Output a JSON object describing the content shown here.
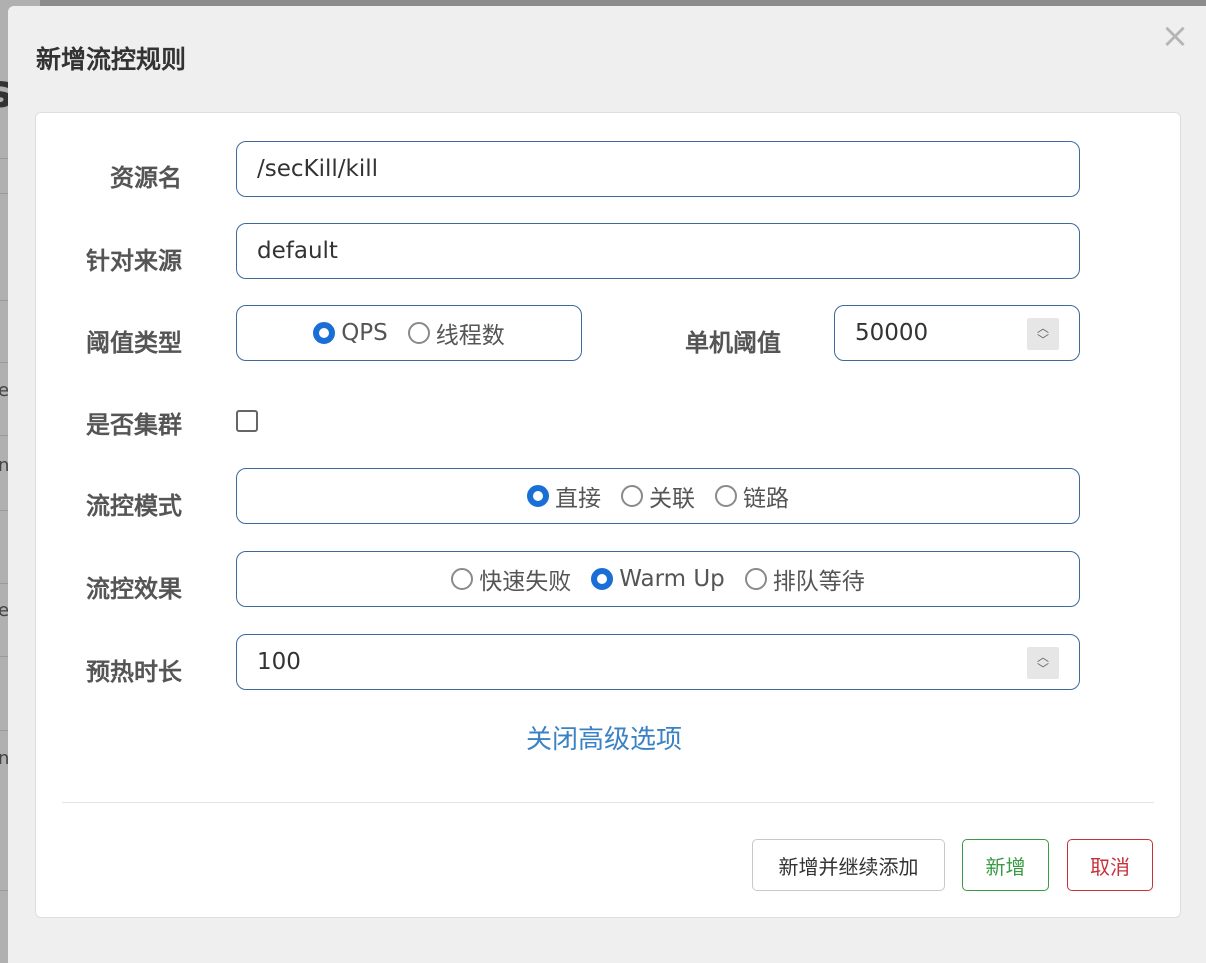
{
  "dialog": {
    "title": "新增流控规则",
    "close_glyph": "×"
  },
  "form": {
    "resource": {
      "label": "资源名",
      "value": "/secKill/kill"
    },
    "limit_app": {
      "label": "针对来源",
      "value": "default"
    },
    "threshold_type": {
      "label": "阈值类型",
      "options": [
        "QPS",
        "线程数"
      ],
      "selected": "QPS"
    },
    "single_threshold": {
      "label": "单机阈值",
      "value": "50000"
    },
    "cluster": {
      "label": "是否集群",
      "checked": false
    },
    "control_mode": {
      "label": "流控模式",
      "options": [
        "直接",
        "关联",
        "链路"
      ],
      "selected": "直接"
    },
    "control_effect": {
      "label": "流控效果",
      "options": [
        "快速失败",
        "Warm Up",
        "排队等待"
      ],
      "selected": "Warm Up"
    },
    "warmup_period": {
      "label": "预热时长",
      "value": "100"
    },
    "toggle_advanced_link": "关闭高级选项"
  },
  "footer": {
    "add_continue_label": "新增并继续添加",
    "add_label": "新增",
    "cancel_label": "取消"
  },
  "backdrop": {
    "heading_fragment": "s",
    "row_fragments": [
      "e",
      "n'",
      "e",
      "n'"
    ]
  },
  "colors": {
    "primary": "#1a6fd6",
    "input_border": "#3d6a9e",
    "link": "#3b82c4",
    "success": "#3a9b45",
    "danger": "#c7323a"
  }
}
